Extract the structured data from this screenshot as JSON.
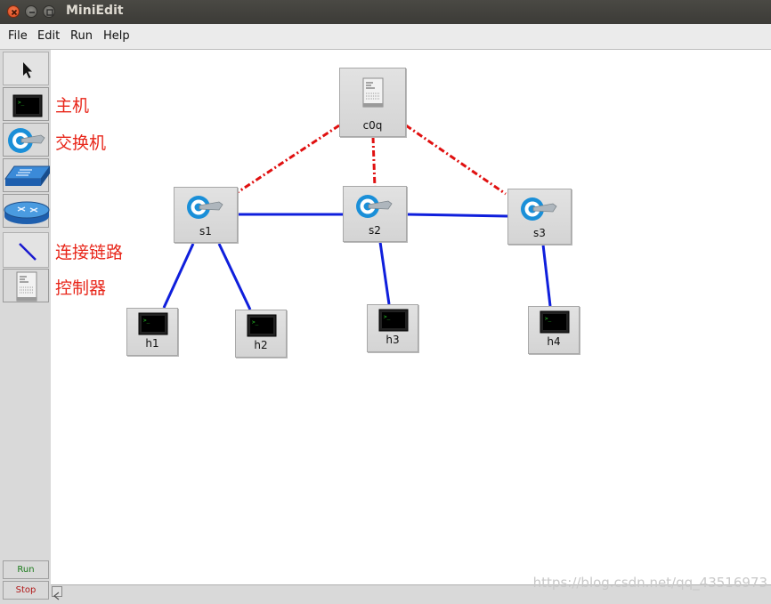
{
  "window": {
    "title": "MiniEdit"
  },
  "menu": [
    "File",
    "Edit",
    "Run",
    "Help"
  ],
  "toolbar": {
    "run_label": "Run",
    "stop_label": "Stop"
  },
  "annotations": {
    "host": "主机",
    "switch": "交换机",
    "link": "连接链路",
    "controller": "控制器"
  },
  "nodes": {
    "controller": "c0q",
    "s1": "s1",
    "s2": "s2",
    "s3": "s3",
    "h1": "h1",
    "h2": "h2",
    "h3": "h3",
    "h4": "h4"
  },
  "watermark": "https://blog.csdn.net/qq_43516973",
  "colors": {
    "link": "#0f1fdc",
    "controller_link": "#e01010",
    "annotation": "#e8261a",
    "run": "#1a7a1a",
    "stop": "#b01818"
  }
}
